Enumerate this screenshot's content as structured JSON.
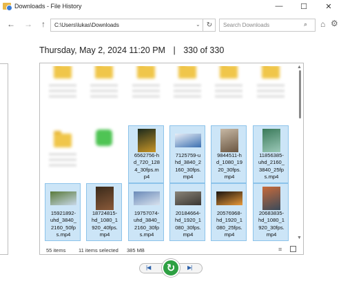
{
  "window": {
    "title": "Downloads - File History",
    "controls": {
      "minimize": "—",
      "maximize": "☐",
      "close": "✕"
    }
  },
  "nav": {
    "back": "←",
    "forward": "→",
    "up": "↑",
    "address": "C:\\Users\\lukas\\Downloads",
    "dropdown": "⌄",
    "refresh": "↻",
    "search_placeholder": "Search Downloads",
    "search_icon": "⌕",
    "home_icon": "⌂",
    "settings_icon": "⚙"
  },
  "backup": {
    "datetime": "Thursday, May 2, 2024 11:20 PM",
    "separator": "|",
    "position": "330 of 330"
  },
  "files": {
    "row1": [
      {
        "icon": "folder-icon"
      },
      {
        "icon": "folder-icon"
      },
      {
        "icon": "folder-icon"
      },
      {
        "icon": "folder-icon"
      },
      {
        "icon": "folder-icon"
      },
      {
        "icon": "folder-icon"
      }
    ],
    "row2": [
      {
        "icon": "folder-icon"
      },
      {
        "icon": "messages-app-icon"
      },
      {
        "name": "6562756-hd_720_1284_30fps.mp4",
        "label": "6562756-h\nd_720_128\n4_30fps.m\np4",
        "selected": true,
        "thumb": [
          "#1c2a1c",
          "#c89628"
        ]
      },
      {
        "name": "7125759-uhd_3840_2160_30fps.mp4",
        "label": "7125759-u\nhd_3840_2\n160_30fps.\nmp4",
        "selected": true,
        "thumb": [
          "#e8eef6",
          "#3b6fb0"
        ]
      },
      {
        "name": "9844511-hd_1080_1920_30fps.mp4",
        "label": "9844511-h\nd_1080_19\n20_30fps.\nmp4",
        "selected": true,
        "thumb": [
          "#c7b8a4",
          "#6a5642"
        ]
      },
      {
        "name": "11856385-uhd_2160_3840_25fps.mp4",
        "label": "11856385-\nuhd_2160_\n3840_25fp\ns.mp4",
        "selected": true,
        "thumb": [
          "#3a7a5a",
          "#9bc8b8"
        ]
      }
    ],
    "row3": [
      {
        "name": "15921892-uhd_3840_2160_50fps.mp4",
        "label": "15921892-\nuhd_3840_\n2160_50fp\ns.mp4",
        "selected": true,
        "thumb": [
          "#5a7a3a",
          "#c8d8e8"
        ]
      },
      {
        "name": "18724815-hd_1080_1920_40fps.mp4",
        "label": "18724815-\nhd_1080_1\n920_40fps.\nmp4",
        "selected": true,
        "thumb": [
          "#3a2a1a",
          "#8a5a3a"
        ]
      },
      {
        "name": "19757074-uhd_3840_2160_30fps.mp4",
        "label": "19757074-\nuhd_3840_\n2160_30fp\ns.mp4",
        "selected": true,
        "thumb": [
          "#6a8ab8",
          "#d8e2ee"
        ]
      },
      {
        "name": "20184664-hd_1920_1080_30fps.mp4",
        "label": "20184664-\nhd_1920_1\n080_30fps.\nmp4",
        "selected": true,
        "thumb": [
          "#8a8478",
          "#3a3632"
        ]
      },
      {
        "name": "20576968-hd_1920_1080_25fps.mp4",
        "label": "20576968-\nhd_1920_1\n080_25fps.\nmp4",
        "selected": true,
        "thumb": [
          "#1a1410",
          "#e89838"
        ]
      },
      {
        "name": "20683835-hd_1080_1920_30fps.mp4",
        "label": "20683835-\nhd_1080_1\n920_30fps.\nmp4",
        "selected": true,
        "thumb": [
          "#c86a3a",
          "#3a4a5a"
        ]
      }
    ]
  },
  "status": {
    "count": "55 items",
    "selected": "11 items selected",
    "size": "385 MB"
  },
  "playback": {
    "previous": "|◀",
    "restore": "↻",
    "next": "▶|"
  }
}
